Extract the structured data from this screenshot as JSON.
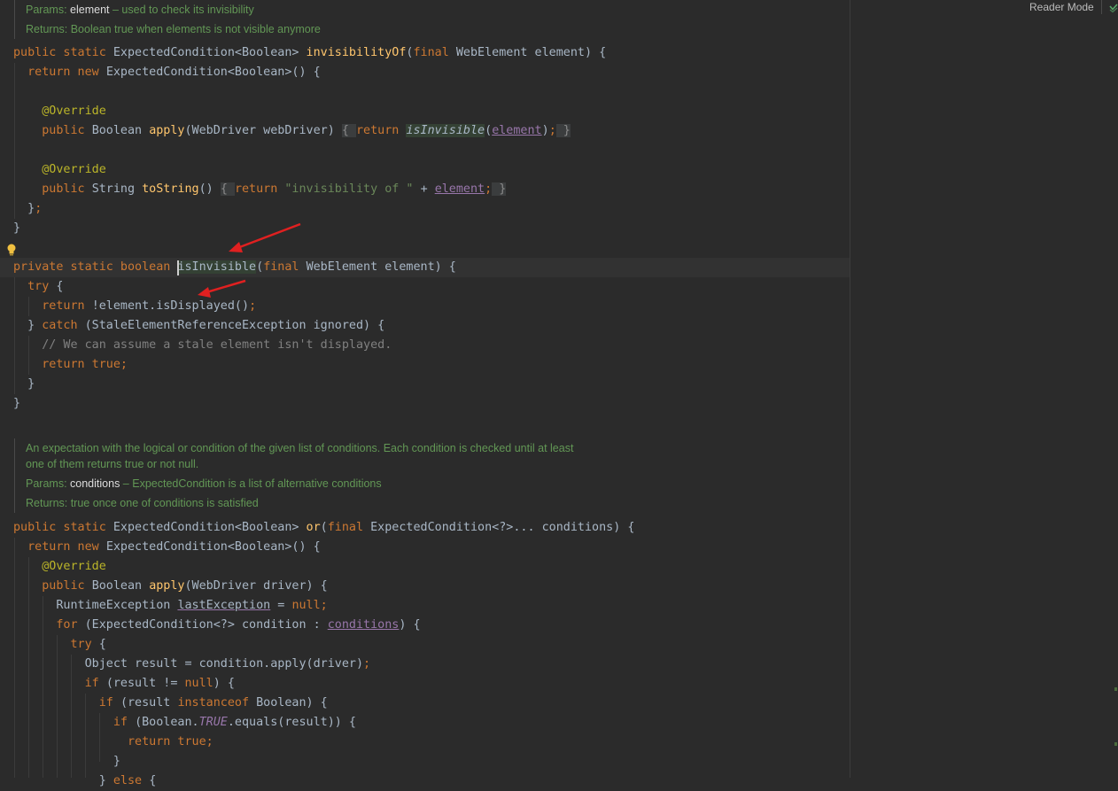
{
  "toolbar": {
    "reader_mode": "Reader Mode"
  },
  "doc1": {
    "params_label": "Params:",
    "params_name": "element",
    "params_desc": " – used to check its invisibility",
    "returns": "Returns: Boolean true when elements is not visible anymore"
  },
  "doc2": {
    "description": "An expectation with the logical or condition of the given list of conditions. Each condition is checked until at least one of them returns true or not null.",
    "params_label": "Params:",
    "params_name": "conditions",
    "params_desc": " – ExpectedCondition is a list of alternative conditions",
    "returns": "Returns: true once one of conditions is satisfied"
  },
  "block1": [
    {
      "indent": 0,
      "tokens": [
        [
          "kw",
          "public static "
        ],
        [
          "p",
          "ExpectedCondition<Boolean> "
        ],
        [
          "fn",
          "invisibilityOf"
        ],
        [
          "p",
          "("
        ],
        [
          "kw",
          "final "
        ],
        [
          "p",
          "WebElement element) {"
        ]
      ]
    },
    {
      "indent": 1,
      "tokens": [
        [
          "kw",
          "return new "
        ],
        [
          "p",
          "ExpectedCondition<Boolean>() {"
        ]
      ]
    },
    {
      "indent": 0,
      "tokens": []
    },
    {
      "indent": 2,
      "tokens": [
        [
          "an",
          "@Override"
        ]
      ]
    },
    {
      "indent": 2,
      "tokens": [
        [
          "kw",
          "public "
        ],
        [
          "p",
          "Boolean "
        ],
        [
          "fn",
          "apply"
        ],
        [
          "p",
          "(WebDriver webDriver) "
        ],
        [
          "fold",
          "{ "
        ],
        [
          "kw",
          "return "
        ],
        [
          "hlit",
          "isInvisible"
        ],
        [
          "p",
          "("
        ],
        [
          "fldu",
          "element"
        ],
        [
          "p",
          ")"
        ],
        [
          "kw",
          ";"
        ],
        [
          "fold",
          " }"
        ]
      ]
    },
    {
      "indent": 0,
      "tokens": []
    },
    {
      "indent": 2,
      "tokens": [
        [
          "an",
          "@Override"
        ]
      ]
    },
    {
      "indent": 2,
      "tokens": [
        [
          "kw",
          "public "
        ],
        [
          "p",
          "String "
        ],
        [
          "fn",
          "toString"
        ],
        [
          "p",
          "() "
        ],
        [
          "fold",
          "{ "
        ],
        [
          "kw",
          "return "
        ],
        [
          "st",
          "\"invisibility of \" "
        ],
        [
          "p",
          "+ "
        ],
        [
          "fldu",
          "element"
        ],
        [
          "kw",
          ";"
        ],
        [
          "fold",
          " }"
        ]
      ]
    },
    {
      "indent": 1,
      "tokens": [
        [
          "p",
          "}"
        ],
        [
          "kw",
          ";"
        ]
      ]
    },
    {
      "indent": 0,
      "tokens": [
        [
          "p",
          "}"
        ]
      ]
    },
    {
      "indent": 0,
      "tokens": []
    },
    {
      "indent": 0,
      "caret": true,
      "tokens": [
        [
          "kw",
          "private static boolean "
        ],
        [
          "hlfn",
          "isInvisible"
        ],
        [
          "p",
          "("
        ],
        [
          "kw",
          "final "
        ],
        [
          "p",
          "WebElement element) {"
        ]
      ]
    },
    {
      "indent": 1,
      "tokens": [
        [
          "kw",
          "try "
        ],
        [
          "p",
          "{"
        ]
      ]
    },
    {
      "indent": 2,
      "tokens": [
        [
          "kw",
          "return "
        ],
        [
          "p",
          "!element.isDisplayed()"
        ],
        [
          "kw",
          ";"
        ]
      ]
    },
    {
      "indent": 1,
      "tokens": [
        [
          "p",
          "} "
        ],
        [
          "kw",
          "catch "
        ],
        [
          "p",
          "(StaleElementReferenceException ignored) {"
        ]
      ]
    },
    {
      "indent": 2,
      "tokens": [
        [
          "cm",
          "// We can assume a stale element isn't displayed."
        ]
      ]
    },
    {
      "indent": 2,
      "tokens": [
        [
          "kw",
          "return true;"
        ]
      ]
    },
    {
      "indent": 1,
      "tokens": [
        [
          "p",
          "}"
        ]
      ]
    },
    {
      "indent": 0,
      "tokens": [
        [
          "p",
          "}"
        ]
      ]
    }
  ],
  "block2": [
    {
      "indent": 0,
      "tokens": [
        [
          "kw",
          "public static "
        ],
        [
          "p",
          "ExpectedCondition<Boolean> "
        ],
        [
          "fn",
          "or"
        ],
        [
          "p",
          "("
        ],
        [
          "kw",
          "final "
        ],
        [
          "p",
          "ExpectedCondition<?>... conditions) {"
        ]
      ]
    },
    {
      "indent": 1,
      "tokens": [
        [
          "kw",
          "return new "
        ],
        [
          "p",
          "ExpectedCondition<Boolean>() {"
        ]
      ]
    },
    {
      "indent": 2,
      "tokens": [
        [
          "an",
          "@Override"
        ]
      ]
    },
    {
      "indent": 2,
      "tokens": [
        [
          "kw",
          "public "
        ],
        [
          "p",
          "Boolean "
        ],
        [
          "fn",
          "apply"
        ],
        [
          "p",
          "(WebDriver driver) {"
        ]
      ]
    },
    {
      "indent": 3,
      "tokens": [
        [
          "p",
          "RuntimeException "
        ],
        [
          "ul",
          "lastException"
        ],
        [
          "p",
          " = "
        ],
        [
          "kw",
          "null;"
        ]
      ]
    },
    {
      "indent": 3,
      "tokens": [
        [
          "kw",
          "for "
        ],
        [
          "p",
          "(ExpectedCondition<?> condition : "
        ],
        [
          "fldu",
          "conditions"
        ],
        [
          "p",
          ") {"
        ]
      ]
    },
    {
      "indent": 4,
      "tokens": [
        [
          "kw",
          "try "
        ],
        [
          "p",
          "{"
        ]
      ]
    },
    {
      "indent": 5,
      "tokens": [
        [
          "p",
          "Object result = condition.apply(driver)"
        ],
        [
          "kw",
          ";"
        ]
      ]
    },
    {
      "indent": 5,
      "tokens": [
        [
          "kw",
          "if "
        ],
        [
          "p",
          "(result != "
        ],
        [
          "kw",
          "null"
        ],
        [
          "p",
          ") {"
        ]
      ]
    },
    {
      "indent": 6,
      "tokens": [
        [
          "kw",
          "if "
        ],
        [
          "p",
          "(result "
        ],
        [
          "kw",
          "instanceof "
        ],
        [
          "p",
          "Boolean) {"
        ]
      ]
    },
    {
      "indent": 7,
      "tokens": [
        [
          "kw",
          "if "
        ],
        [
          "p",
          "(Boolean."
        ],
        [
          "fldi",
          "TRUE"
        ],
        [
          "p",
          ".equals(result)) {"
        ]
      ]
    },
    {
      "indent": 8,
      "tokens": [
        [
          "kw",
          "return true;"
        ]
      ]
    },
    {
      "indent": 7,
      "tokens": [
        [
          "p",
          "}"
        ]
      ]
    },
    {
      "indent": 6,
      "tokens": [
        [
          "p",
          "} "
        ],
        [
          "kw",
          "else "
        ],
        [
          "p",
          "{"
        ]
      ]
    }
  ]
}
